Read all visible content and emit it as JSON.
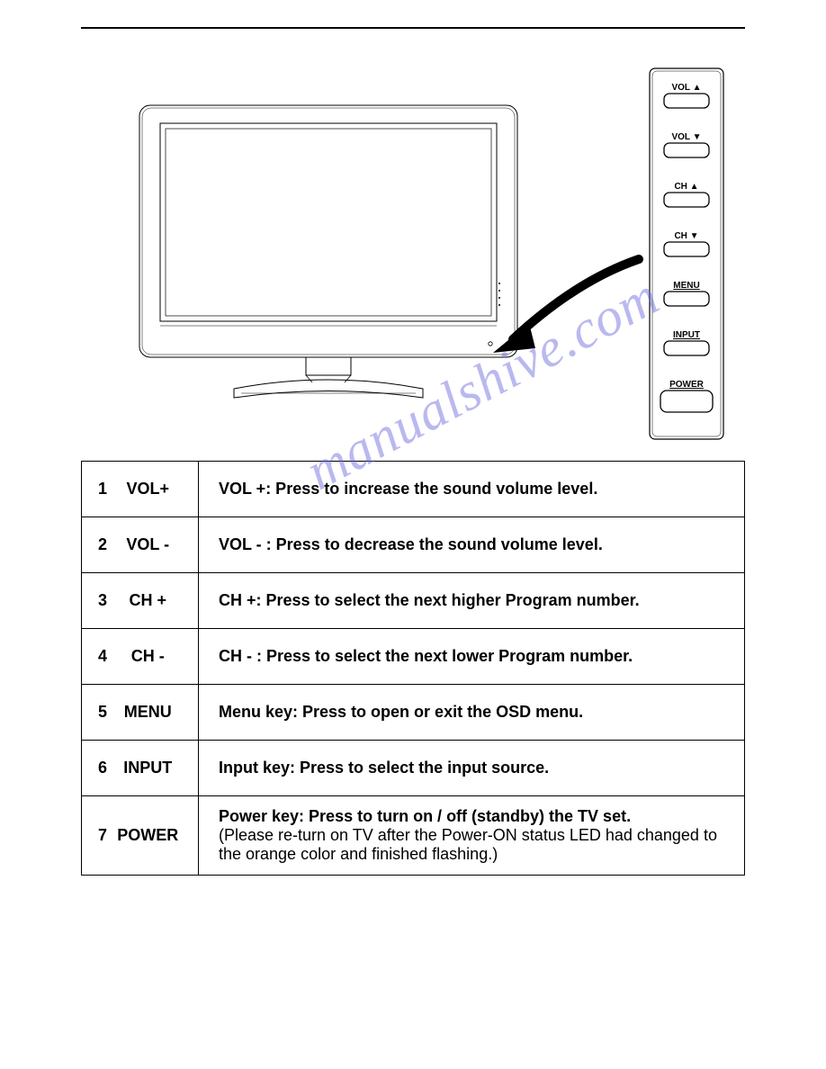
{
  "watermark": "manualshive.com",
  "panel_buttons": [
    {
      "label": "VOL ▲"
    },
    {
      "label": "VOL ▼"
    },
    {
      "label": "CH ▲"
    },
    {
      "label": "CH ▼"
    },
    {
      "label": "MENU"
    },
    {
      "label": "INPUT"
    },
    {
      "label": "POWER"
    }
  ],
  "rows": [
    {
      "num": "1",
      "label": "VOL+",
      "desc": "VOL +: Press to increase the sound volume level.",
      "sub": ""
    },
    {
      "num": "2",
      "label": "VOL -",
      "desc": "VOL - : Press to decrease the sound volume level.",
      "sub": ""
    },
    {
      "num": "3",
      "label": "CH +",
      "desc": "CH +: Press to select the next higher Program number.",
      "sub": ""
    },
    {
      "num": "4",
      "label": "CH -",
      "desc": "CH - : Press to select the next lower Program number.",
      "sub": ""
    },
    {
      "num": "5",
      "label": "MENU",
      "desc": "Menu key: Press to open or exit the OSD menu.",
      "sub": ""
    },
    {
      "num": "6",
      "label": "INPUT",
      "desc": "Input key: Press to select the input source.",
      "sub": ""
    },
    {
      "num": "7",
      "label": "POWER",
      "desc": "Power key: Press to turn on / off (standby) the TV set.",
      "sub": "(Please re-turn on TV after the Power-ON status LED had changed to the orange color and finished flashing.)"
    }
  ]
}
